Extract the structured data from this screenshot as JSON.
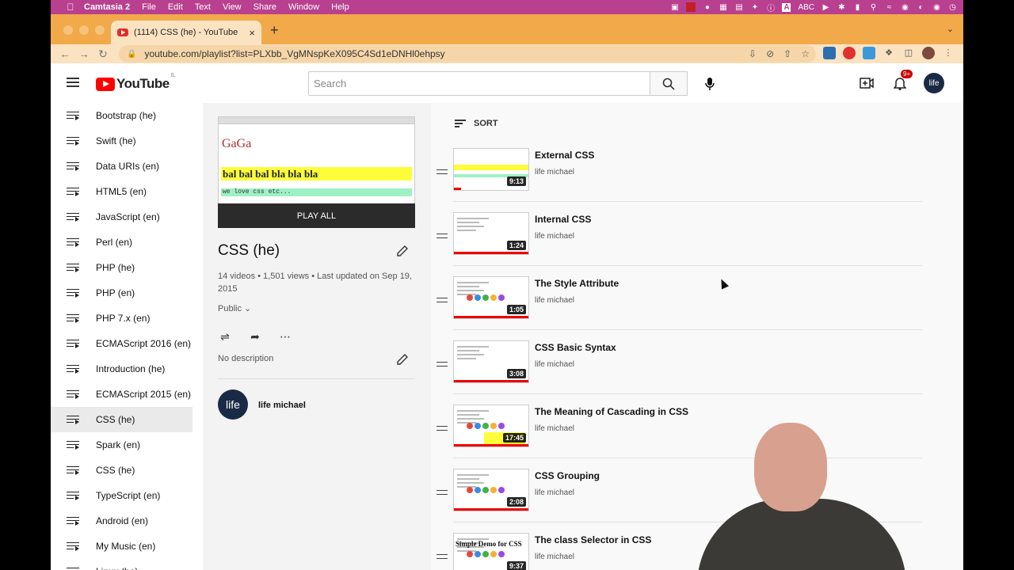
{
  "menubar": {
    "app_name": "Camtasia 2",
    "items": [
      "File",
      "Edit",
      "Text",
      "View",
      "Share",
      "Window",
      "Help"
    ],
    "abc_label": "ABC"
  },
  "browser": {
    "tab_title": "(1114) CSS (he) - YouTube",
    "url": "youtube.com/playlist?list=PLXbb_VgMNspKeX095C4Sd1eDNHl0ehpsy"
  },
  "youtube": {
    "logo_text": "YouTube",
    "logo_cc": "IL",
    "search_placeholder": "Search",
    "notification_count": "9+",
    "avatar_label": "life"
  },
  "sidebar": {
    "items": [
      "Bootstrap (he)",
      "Swift (he)",
      "Data URIs (en)",
      "HTML5 (en)",
      "JavaScript (en)",
      "Perl (en)",
      "PHP (he)",
      "PHP (en)",
      "PHP 7.x (en)",
      "ECMAScript 2016 (en)",
      "Introduction (he)",
      "ECMAScript 2015 (en)",
      "CSS (he)",
      "Spark (en)",
      "CSS (he)",
      "TypeScript (en)",
      "Android (en)",
      "My Music (en)",
      "Linux (he)"
    ],
    "active_index": 12
  },
  "playlist": {
    "thumb_brand": "GaGa",
    "thumb_yellow_text": "bal bal bal bla bla bla",
    "thumb_green_text": "we love css etc...",
    "play_all_label": "PLAY ALL",
    "title": "CSS (he)",
    "meta": "14 videos • 1,501 views • Last updated on Sep 19, 2015",
    "privacy": "Public",
    "description": "No description",
    "owner": "life michael",
    "owner_avatar": "life"
  },
  "videos": {
    "sort_label": "SORT",
    "items": [
      {
        "title": "External CSS",
        "channel": "life michael",
        "duration": "9:13"
      },
      {
        "title": "Internal CSS",
        "channel": "life michael",
        "duration": "1:24"
      },
      {
        "title": "The Style Attribute",
        "channel": "life michael",
        "duration": "1:05"
      },
      {
        "title": "CSS Basic Syntax",
        "channel": "life michael",
        "duration": "3:08"
      },
      {
        "title": "The Meaning of Cascading in CSS",
        "channel": "life michael",
        "duration": "17:45"
      },
      {
        "title": "CSS Grouping",
        "channel": "life michael",
        "duration": "2:08"
      },
      {
        "title": "The class Selector in CSS",
        "channel": "life michael",
        "duration": "9:37",
        "thumb_text": "Simple Demo for CSS"
      }
    ]
  },
  "colors": {
    "menubar": "#b8408f",
    "tabstrip": "#f2a94a",
    "youtube_red": "#ff0000",
    "active_sidebar": "#eaeaea"
  }
}
